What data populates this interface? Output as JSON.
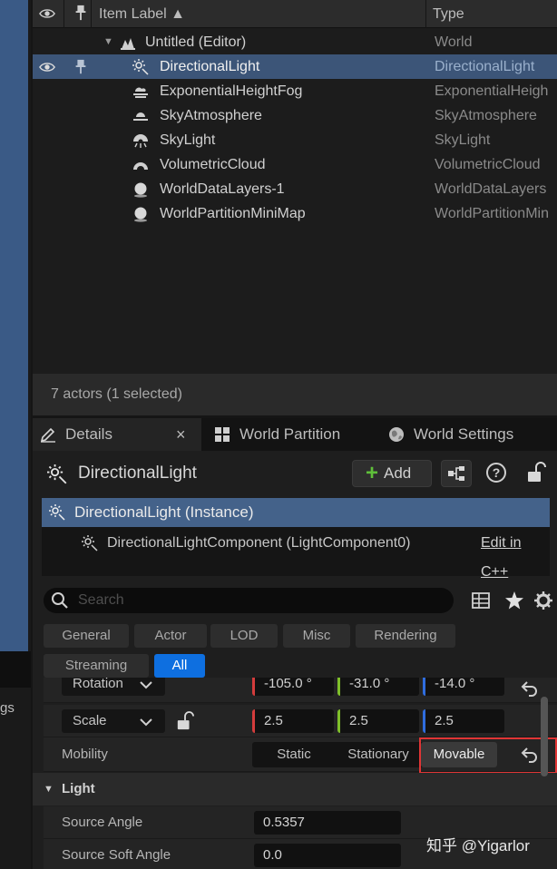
{
  "left_panel": {
    "partial_label": "gs"
  },
  "outliner": {
    "columns": {
      "label": "Item Label ▲",
      "type": "Type"
    },
    "rows": [
      {
        "label": "Untitled (Editor)",
        "type": "World",
        "icon": "level-icon"
      },
      {
        "label": "DirectionalLight",
        "type": "DirectionalLight",
        "icon": "sun-icon"
      },
      {
        "label": "ExponentialHeightFog",
        "type": "ExponentialHeigh",
        "icon": "fog-icon"
      },
      {
        "label": "SkyAtmosphere",
        "type": "SkyAtmosphere",
        "icon": "atmosphere-icon"
      },
      {
        "label": "SkyLight",
        "type": "SkyLight",
        "icon": "skylight-icon"
      },
      {
        "label": "VolumetricCloud",
        "type": "VolumetricCloud",
        "icon": "cloud-icon"
      },
      {
        "label": "WorldDataLayers-1",
        "type": "WorldDataLayers",
        "icon": "sphere-icon"
      },
      {
        "label": "WorldPartitionMiniMap",
        "type": "WorldPartitionMin",
        "icon": "sphere-icon"
      }
    ],
    "status": "7 actors (1 selected)"
  },
  "tabs": [
    {
      "label": "Details",
      "close": "×"
    },
    {
      "label": "World Partition"
    },
    {
      "label": "World Settings"
    }
  ],
  "details": {
    "actor_name": "DirectionalLight",
    "add_label": "Add",
    "add_symbol": "+",
    "help_symbol": "?",
    "component_instance": "DirectionalLight (Instance)",
    "component": "DirectionalLightComponent (LightComponent0)",
    "edit_cpp": "Edit in C++",
    "search_placeholder": "Search",
    "filters_row1": [
      "General",
      "Actor",
      "LOD",
      "Misc",
      "Rendering"
    ],
    "filters_row2": [
      "Streaming",
      "All"
    ],
    "rotation": {
      "label": "Rotation",
      "x": "-105.0 °",
      "y": "-31.0 °",
      "z": "-14.0 °"
    },
    "scale": {
      "label": "Scale",
      "x": "2.5",
      "y": "2.5",
      "z": "2.5"
    },
    "mobility": {
      "label": "Mobility",
      "options": [
        "Static",
        "Stationary",
        "Movable"
      ],
      "selected": "Movable"
    },
    "light_category": "Light",
    "source_angle": {
      "label": "Source Angle",
      "value": "0.5357"
    },
    "source_soft_angle": {
      "label": "Source Soft Angle",
      "value": "0.0"
    }
  },
  "watermark": "知乎 @Yigarlor",
  "colors": {
    "selection": "#3c5578",
    "accent": "#0e6fe0",
    "x_axis": "#d43c3c",
    "y_axis": "#7fbf2a",
    "z_axis": "#2f6ddf",
    "highlight": "#e03535"
  }
}
